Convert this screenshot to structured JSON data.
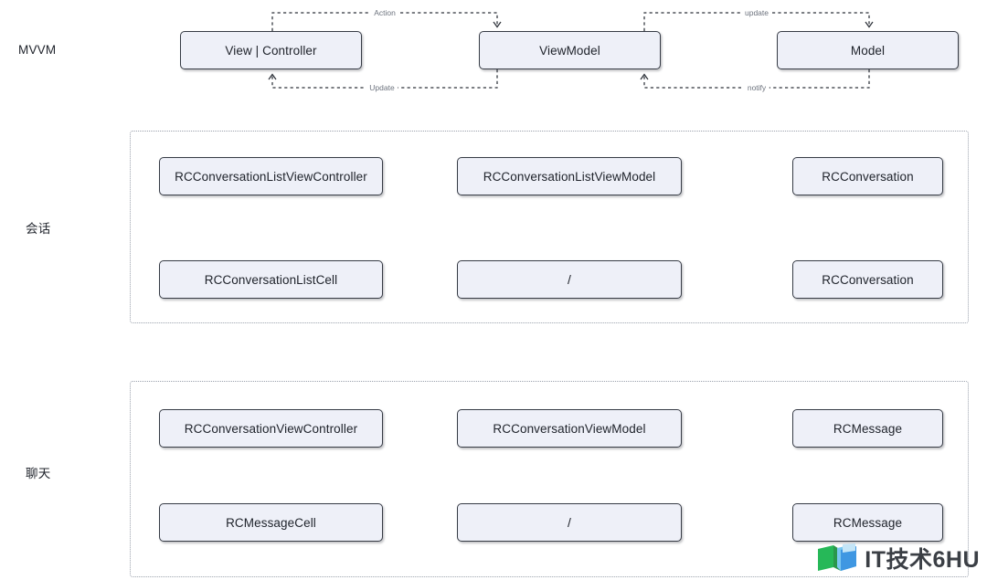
{
  "rows": [
    {
      "label": "MVVM"
    },
    {
      "label": "会话"
    },
    {
      "label": "聊天"
    }
  ],
  "mvvm": {
    "nodes": [
      {
        "label": "View | Controller"
      },
      {
        "label": "ViewModel"
      },
      {
        "label": "Model"
      }
    ],
    "edges": [
      {
        "label": "Action"
      },
      {
        "label": "Update"
      },
      {
        "label": "update"
      },
      {
        "label": "notify"
      }
    ]
  },
  "groups": [
    {
      "name": "conversation-group",
      "rows": [
        [
          {
            "label": "RCConversationListViewController"
          },
          {
            "label": "RCConversationListViewModel"
          },
          {
            "label": "RCConversation"
          }
        ],
        [
          {
            "label": "RCConversationListCell"
          },
          {
            "label": "/"
          },
          {
            "label": "RCConversation"
          }
        ]
      ]
    },
    {
      "name": "chat-group",
      "rows": [
        [
          {
            "label": "RCConversationViewController"
          },
          {
            "label": "RCConversationViewModel"
          },
          {
            "label": "RCMessage"
          }
        ],
        [
          {
            "label": "RCMessageCell"
          },
          {
            "label": "/"
          },
          {
            "label": "RCMessage"
          }
        ]
      ]
    }
  ],
  "watermark": {
    "text": "IT技术6HU"
  },
  "colors": {
    "node_fill": "#eef0f8",
    "node_border": "#363b45",
    "group_border": "#9aa0ac",
    "arrow": "#2f333b",
    "edge_label": "#6d737e",
    "text": "#20242c"
  }
}
